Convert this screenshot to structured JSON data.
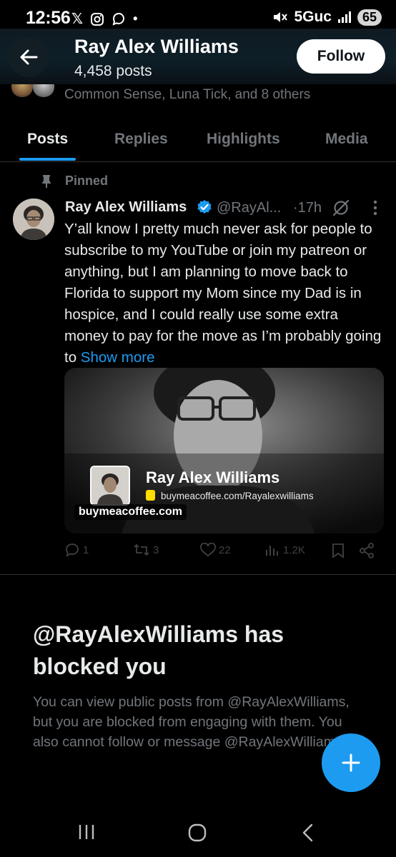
{
  "status_bar": {
    "time": "12:56",
    "network": "5Guc",
    "battery": "65"
  },
  "header": {
    "name": "Ray Alex Williams",
    "posts_count": "4,458 posts",
    "follow_label": "Follow"
  },
  "followers_you_know": "Common Sense, Luna Tick, and 8 others",
  "tabs": [
    {
      "label": "Posts",
      "active": true
    },
    {
      "label": "Replies",
      "active": false
    },
    {
      "label": "Highlights",
      "active": false
    },
    {
      "label": "Media",
      "active": false
    }
  ],
  "post": {
    "pinned_label": "Pinned",
    "author_name": "Ray Alex Williams",
    "handle": "@RayAl...",
    "time": "·17h",
    "body": "Y’all know I pretty much never ask for people to subscribe to my YouTube or join my patreon or anything, but I am planning to move back to Florida to support my Mom since my Dad is in hospice, and I could really use some extra money to pay for the move as I’m probably going to ",
    "show_more": "Show more",
    "card": {
      "title": "Ray Alex Williams",
      "url": "buymeacoffee.com/Rayalexwilliams",
      "domain": "buymeacoffee.com"
    },
    "actions": {
      "replies": "1",
      "reposts": "3",
      "likes": "22",
      "views": "1.2K"
    }
  },
  "blocked": {
    "title": "@RayAlexWilliams has blocked you",
    "body": "You can view public posts from @RayAlexWilliams, but you are blocked from engaging with them. You also cannot follow or message @RayAlexWilliams."
  },
  "colors": {
    "accent": "#1d9bf0",
    "muted": "#71767b",
    "text": "#e7e9ea"
  },
  "icons": {
    "back": "arrow-left-icon",
    "pin": "pin-icon",
    "verified": "verified-badge-icon",
    "grok": "grok-icon",
    "more": "more-vertical-icon",
    "reply": "reply-icon",
    "repost": "repost-icon",
    "like": "heart-icon",
    "views": "views-icon",
    "bookmark": "bookmark-icon",
    "share": "share-icon",
    "compose": "plus-icon"
  }
}
